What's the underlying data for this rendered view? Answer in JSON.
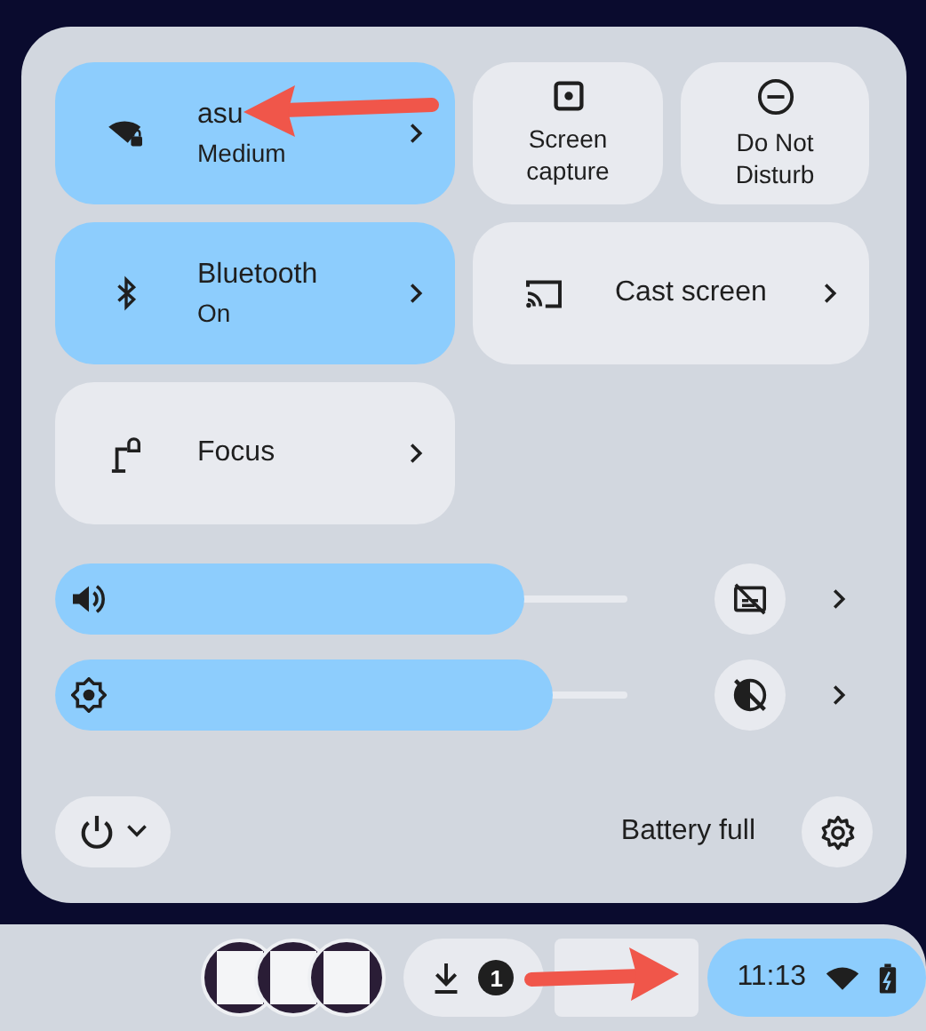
{
  "tiles": [
    {
      "kind": "feature",
      "label": "asu",
      "sublabel": "Medium",
      "on": true
    },
    {
      "kind": "small",
      "label": "Screen capture",
      "on": false
    },
    {
      "kind": "small",
      "label": "Do Not Disturb",
      "on": false
    },
    {
      "kind": "feature",
      "label": "Bluetooth",
      "sublabel": "On",
      "on": true
    },
    {
      "kind": "wide",
      "label": "Cast screen",
      "on": false
    },
    {
      "kind": "feature",
      "label": "Focus",
      "on": false
    }
  ],
  "sliders": [
    {
      "level": 0.82
    },
    {
      "level": 0.87
    }
  ],
  "footer": {
    "battery": "Battery full"
  },
  "shelf": {
    "download_count": "1",
    "time": "11:13"
  }
}
